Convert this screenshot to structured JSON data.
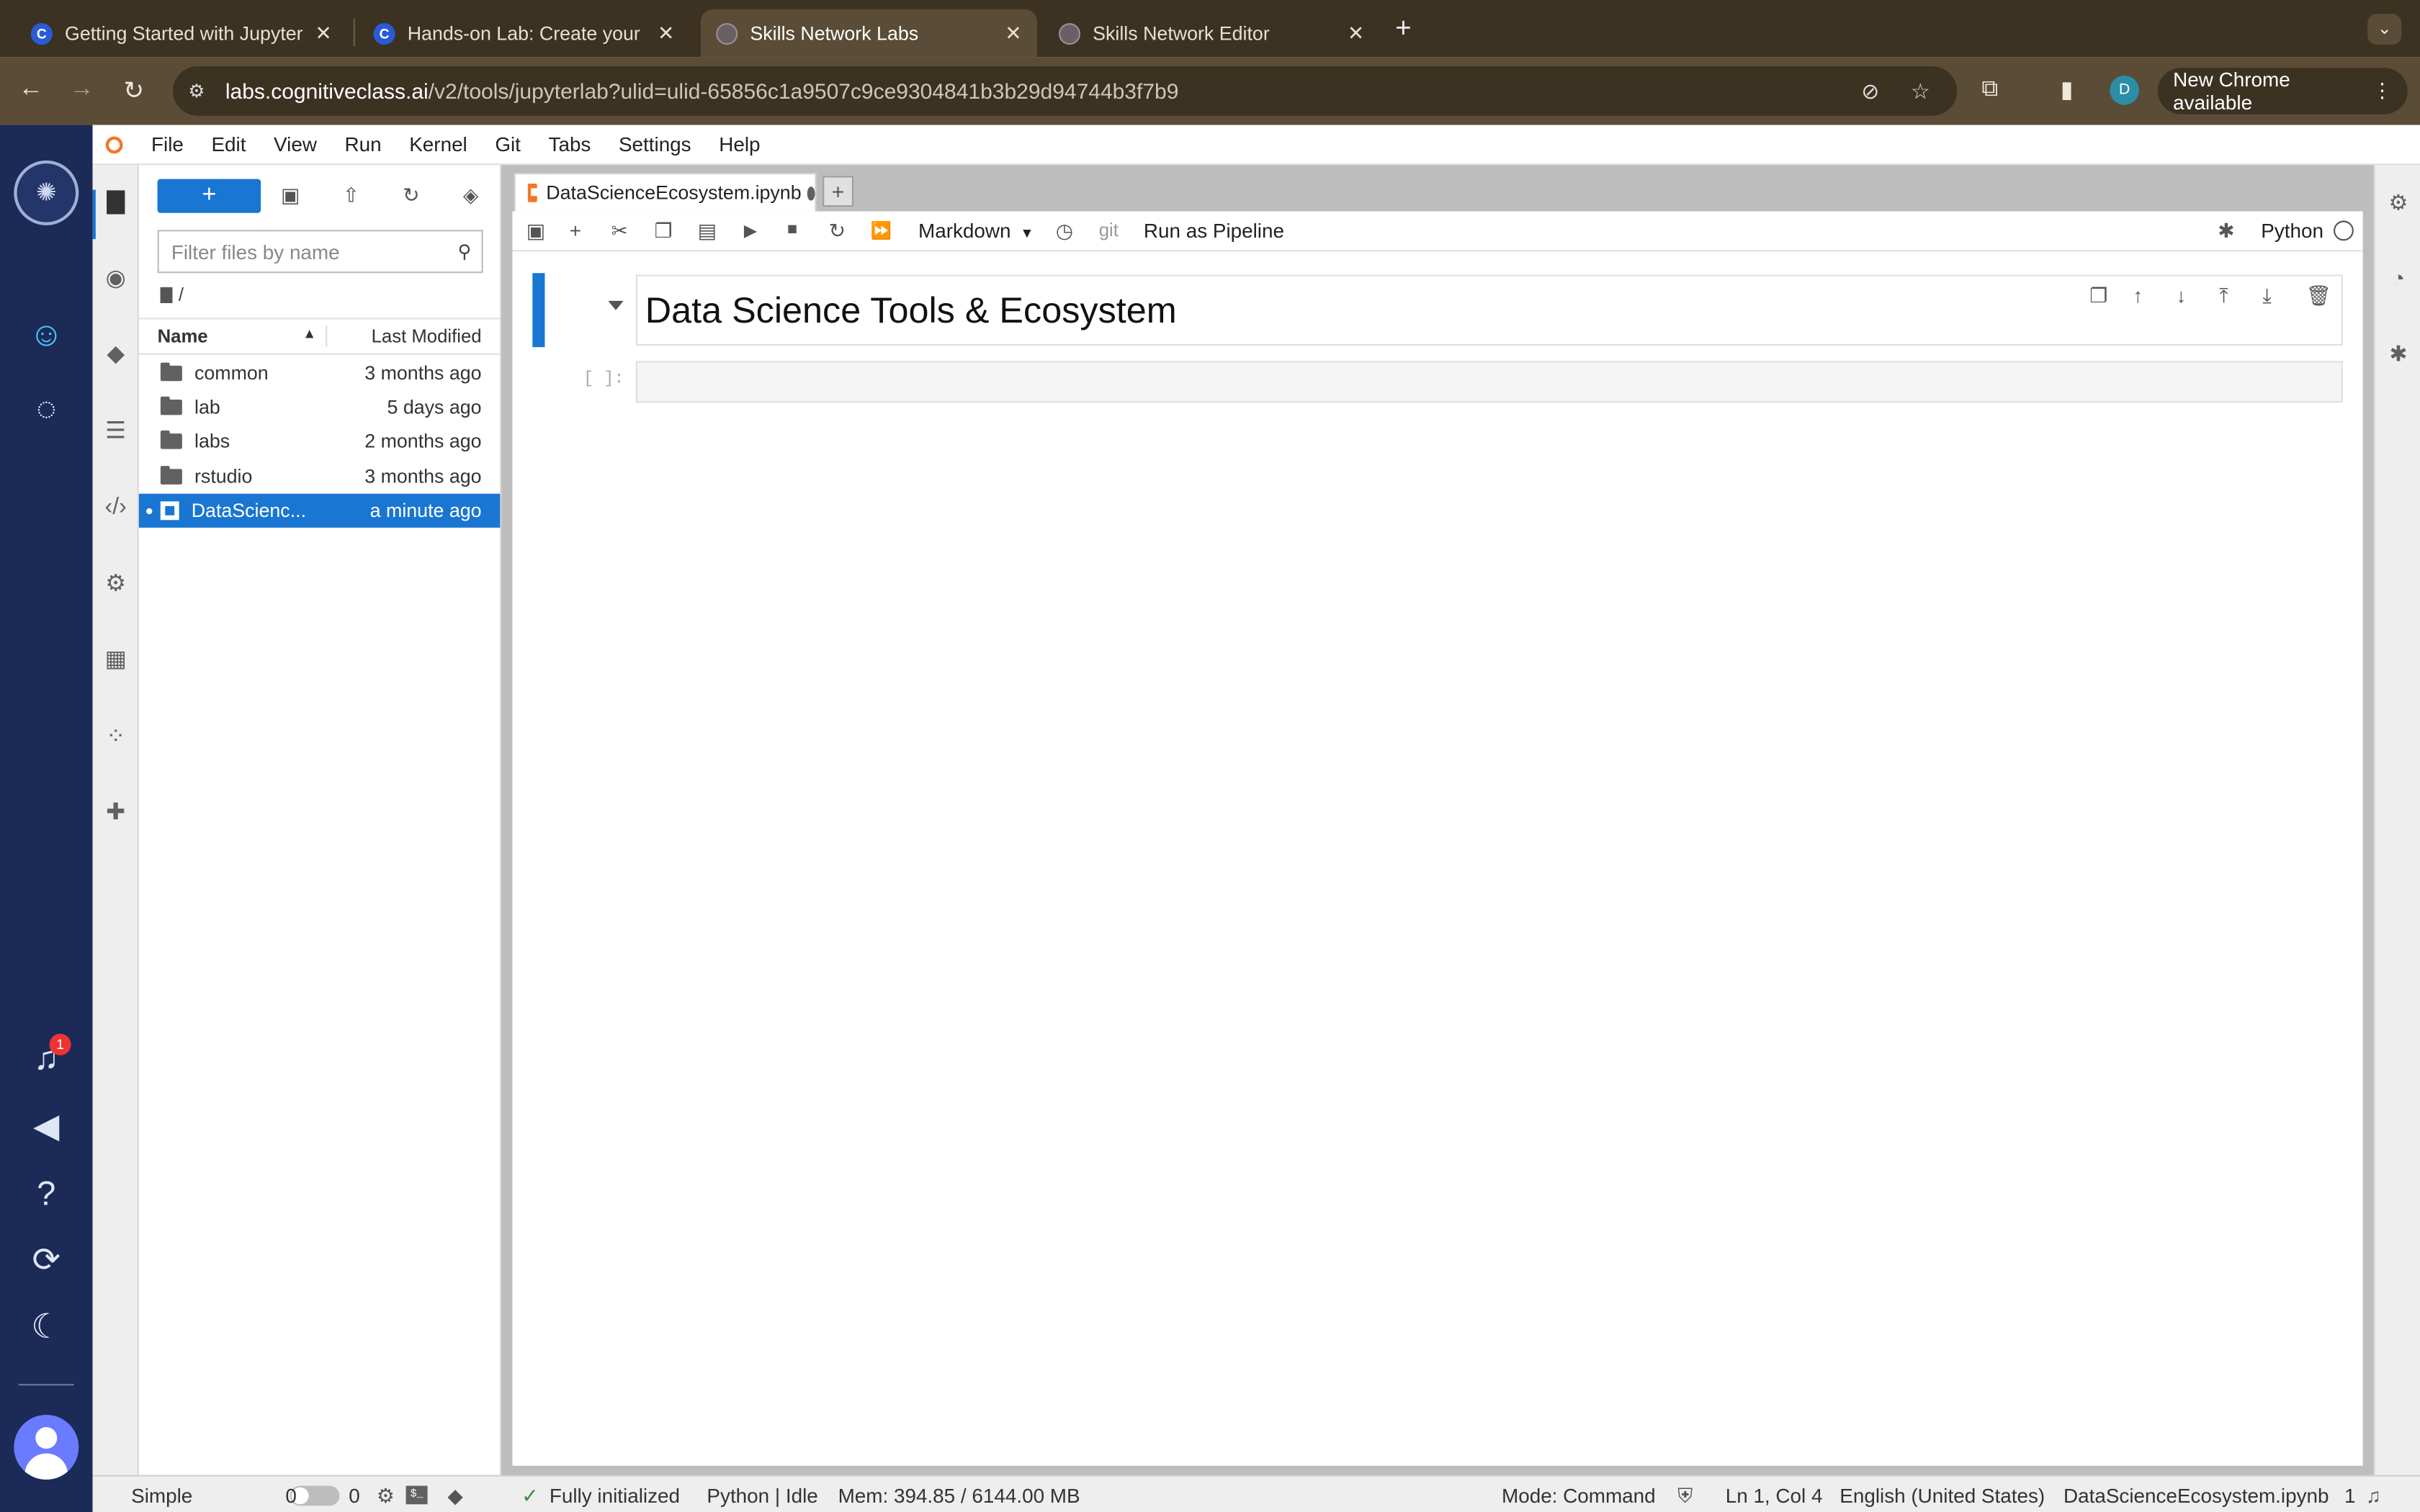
{
  "browser": {
    "tabs": [
      {
        "title": "Getting Started with Jupyter Notebooks",
        "favicon": "C"
      },
      {
        "title": "Hands-on Lab: Create your Jupyter Notebook",
        "favicon": "C"
      },
      {
        "title": "Skills Network Labs",
        "favicon": ""
      },
      {
        "title": "Skills Network Editor",
        "favicon": ""
      }
    ],
    "url_host": "labs.cognitiveclass.ai",
    "url_path": "/v2/tools/jupyterlab?ulid=ulid-65856c1a9507c9ce9304841b3b29d94744b3f7b9",
    "profile_initial": "D",
    "update_label": "New Chrome available"
  },
  "rail": {
    "notification_count": "1"
  },
  "menubar": {
    "items": [
      "File",
      "Edit",
      "View",
      "Run",
      "Kernel",
      "Git",
      "Tabs",
      "Settings",
      "Help"
    ]
  },
  "filebrowser": {
    "new_label": "+",
    "filter_placeholder": "Filter files by name",
    "breadcrumb": "/",
    "col_name": "Name",
    "col_modified": "Last Modified",
    "files": [
      {
        "name": "common",
        "modified": "3 months ago"
      },
      {
        "name": "lab",
        "modified": "5 days ago"
      },
      {
        "name": "labs",
        "modified": "2 months ago"
      },
      {
        "name": "rstudio",
        "modified": "3 months ago"
      },
      {
        "name": "DataScienc...",
        "modified": "a minute ago"
      }
    ]
  },
  "notebook": {
    "tab_title": "DataScienceEcosystem.ipynb",
    "cell_type": "Markdown",
    "git_label": "git",
    "pipeline_label": "Run as Pipeline",
    "kernel_name": "Python",
    "heading": "Data Science Tools & Ecosystem",
    "prompt": "[ ]:"
  },
  "statusbar": {
    "mode_label": "Simple",
    "terminals": "0",
    "kernels": "0",
    "init_status": "Fully initialized",
    "kernel_status": "Python | Idle",
    "memory": "Mem: 394.85 / 6144.00 MB",
    "mode": "Mode: Command",
    "position": "Ln 1, Col 4",
    "language": "English (United States)",
    "filename": "DataScienceEcosystem.ipynb",
    "notif_count": "1"
  },
  "colors": {
    "accent": "#1976d2",
    "rail": "#1b2a57",
    "chrome": "#3c3222"
  }
}
